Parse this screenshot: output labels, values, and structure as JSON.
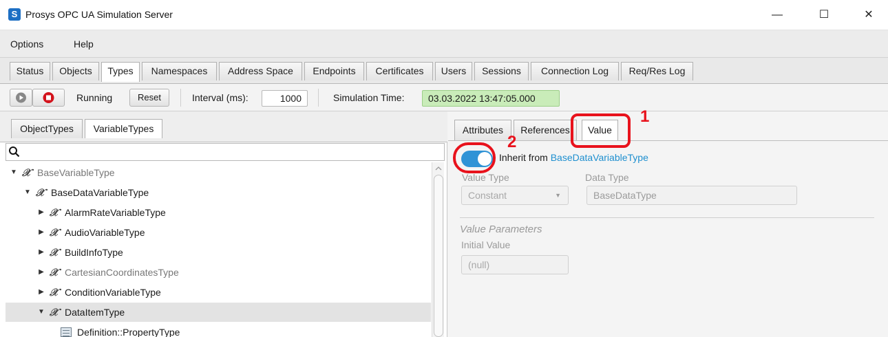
{
  "window": {
    "title": "Prosys OPC UA Simulation Server",
    "icon_letter": "S",
    "minimize": "—",
    "maximize": "☐",
    "close": "✕"
  },
  "menu": [
    "Options",
    "Help"
  ],
  "main_tabs": [
    "Status",
    "Objects",
    "Types",
    "Namespaces",
    "Address Space",
    "Endpoints",
    "Certificates",
    "Users",
    "Sessions",
    "Connection Log",
    "Req/Res Log"
  ],
  "main_tabs_active": "Types",
  "toolbar": {
    "status": "Running",
    "reset_label": "Reset",
    "interval_label": "Interval (ms):",
    "interval_value": "1000",
    "sim_time_label": "Simulation Time:",
    "sim_time_value": "03.03.2022 13:47:05.000"
  },
  "left_tabs": [
    "ObjectTypes",
    "VariableTypes"
  ],
  "left_tabs_active": "VariableTypes",
  "tree": [
    {
      "label": "BaseVariableType",
      "expanded": true,
      "depth": 0,
      "muted": true
    },
    {
      "label": "BaseDataVariableType",
      "expanded": true,
      "depth": 1,
      "muted": false
    },
    {
      "label": "AlarmRateVariableType",
      "expanded": false,
      "depth": 2,
      "muted": false
    },
    {
      "label": "AudioVariableType",
      "expanded": false,
      "depth": 2,
      "muted": false
    },
    {
      "label": "BuildInfoType",
      "expanded": false,
      "depth": 2,
      "muted": false
    },
    {
      "label": "CartesianCoordinatesType",
      "expanded": false,
      "depth": 2,
      "muted": true
    },
    {
      "label": "ConditionVariableType",
      "expanded": false,
      "depth": 2,
      "muted": false
    },
    {
      "label": "DataItemType",
      "expanded": true,
      "depth": 2,
      "muted": false,
      "selected": true
    },
    {
      "label": "Definition::PropertyType",
      "depth": 3,
      "property": true
    }
  ],
  "right_tabs": [
    "Attributes",
    "References",
    "Value"
  ],
  "right_tabs_active": "Value",
  "value_panel": {
    "inherit_prefix": "Inherit from",
    "inherit_link": "BaseDataVariableType",
    "inherit_enabled": true,
    "value_type_label": "Value Type",
    "value_type_value": "Constant",
    "data_type_label": "Data Type",
    "data_type_value": "BaseDataType",
    "params_title": "Value Parameters",
    "initial_value_label": "Initial Value",
    "initial_value_value": "(null)"
  },
  "annotations": [
    "1",
    "2"
  ],
  "colors": {
    "accent": "#2f93d6",
    "annotation": "#e8121c",
    "sim_time_bg": "#c9ecb9",
    "link": "#1e8fcf"
  }
}
